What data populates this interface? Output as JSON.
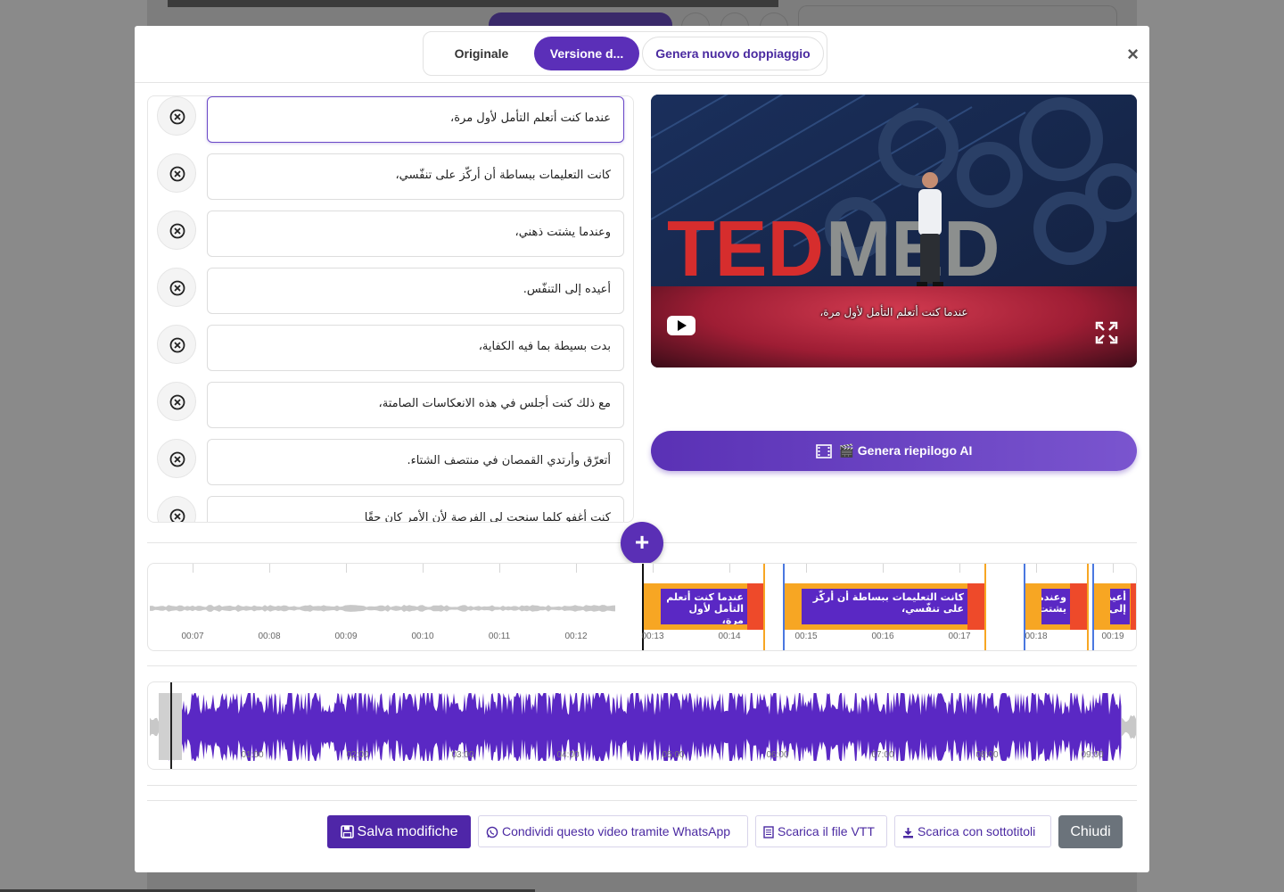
{
  "tabs": {
    "original": "Originale",
    "version": "Versione d...",
    "generate": "Genera nuovo doppiaggio"
  },
  "close_label": "×",
  "subtitles": [
    "عندما كنت أتعلم التأمل لأول مرة،",
    "كانت التعليمات ببساطة أن أركّز على تنفّسي،",
    "وعندما يشتت ذهني،",
    "أعيده إلى التنفّس.",
    "بدت بسيطة بما فيه الكفاية،",
    "مع ذلك كنت أجلس في هذه الانعكاسات الصامتة،",
    "أتعرّق وأرتدي القمصان في منتصف الشتاء.",
    "كنت أغفو كلما سنحت لي الفرصة لأن الأمر كان حقًا"
  ],
  "video": {
    "caption": "عندما كنت أتعلم التأمل لأول مرة،",
    "logo_text": "TEDMED"
  },
  "ai_button": "🎬 Genera riepilogo AI",
  "plus_label": "+",
  "timeline": {
    "labels": [
      "00:07",
      "00:08",
      "00:09",
      "00:10",
      "00:11",
      "00:12",
      "00:13",
      "00:14",
      "00:15",
      "00:16",
      "00:17",
      "00:18",
      "00:19"
    ],
    "segments": [
      "عندما كنت أتعلم التأمل لأول مرة،",
      "كانت التعليمات ببساطة أن أركّز على تنفّسي،",
      "وعندما يشتت",
      "أعيده إلى"
    ]
  },
  "overview": {
    "labels": [
      "01:00",
      "02:00",
      "03:00",
      "04:00",
      "05:00",
      "06:00",
      "07:00",
      "08:00",
      "09:00"
    ]
  },
  "footer": {
    "save": "Salva modifiche",
    "whatsapp": "Condividi questo video tramite WhatsApp",
    "vtt": "Scarica il file VTT",
    "download_subs": "Scarica con sottotitoli",
    "close": "Chiudi"
  },
  "colors": {
    "accent": "#5b2fb8",
    "segment_orange": "#f7a623",
    "segment_red": "#ee4a2a",
    "waveform": "#5a28c4"
  }
}
